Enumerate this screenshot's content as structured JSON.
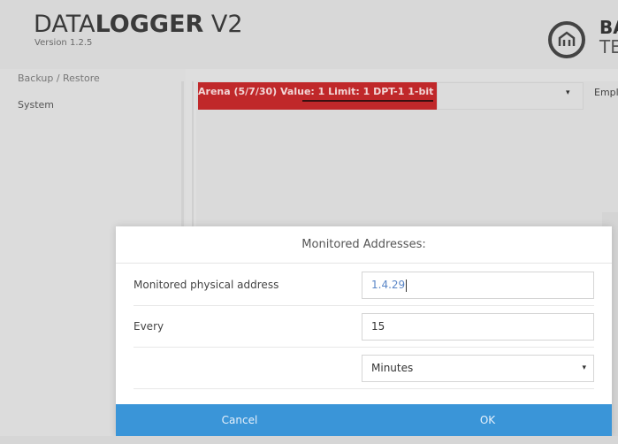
{
  "header": {
    "title_light": "DATA",
    "title_bold": "LOGGER",
    "title_suffix": " V2",
    "version": "Version 1.2.5",
    "brand_line1": "BA",
    "brand_line2": "TE"
  },
  "sidebar": {
    "items": [
      {
        "label": "Backup / Restore"
      },
      {
        "label": "System"
      }
    ]
  },
  "alarm": {
    "text": "Arena (5/7/30) Value: 1 Limit: 1 DPT-1 1-bit"
  },
  "background_select": {
    "caret": "▾",
    "truncated_label": "Empl"
  },
  "modal": {
    "title": "Monitored Addresses:",
    "fields": [
      {
        "label": "Monitored physical address",
        "value": "1.4.29"
      },
      {
        "label": "Every",
        "value": "15"
      },
      {
        "label": "",
        "value": "Minutes"
      }
    ],
    "cancel_label": "Cancel",
    "ok_label": "OK"
  },
  "colors": {
    "alarm_red": "#c0282a",
    "footer_blue": "#3a95d8",
    "link_blue": "#5a86c7"
  }
}
